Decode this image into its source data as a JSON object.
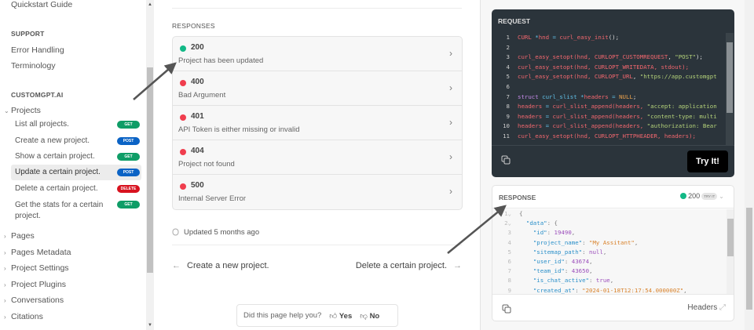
{
  "sidebar": {
    "quickstart": "Quickstart Guide",
    "support_heading": "SUPPORT",
    "support_links": [
      "Error Handling",
      "Terminology"
    ],
    "section_heading": "CUSTOMGPT.AI",
    "expanded_group": "Projects",
    "items": [
      {
        "label": "List all projects.",
        "method": "GET",
        "color": "#0f9d67"
      },
      {
        "label": "Create a new project.",
        "method": "POST",
        "color": "#0b63c5"
      },
      {
        "label": "Show a certain project.",
        "method": "GET",
        "color": "#0f9d67"
      },
      {
        "label": "Update a certain project.",
        "method": "POST",
        "color": "#0b63c5",
        "active": true
      },
      {
        "label": "Delete a certain project.",
        "method": "DELETE",
        "color": "#d8121f"
      },
      {
        "label": "Get the stats for a certain project.",
        "method": "GET",
        "color": "#0f9d67"
      }
    ],
    "groups": [
      "Pages",
      "Pages Metadata",
      "Project Settings",
      "Project Plugins",
      "Conversations",
      "Citations"
    ]
  },
  "main": {
    "responses_label": "RESPONSES",
    "responses": [
      {
        "code": "200",
        "description": "Project has been updated",
        "color": "#12b886"
      },
      {
        "code": "400",
        "description": "Bad Argument",
        "color": "#f03e4e"
      },
      {
        "code": "401",
        "description": "API Token is either missing or invalid",
        "color": "#f03e4e"
      },
      {
        "code": "404",
        "description": "Project not found",
        "color": "#f03e4e"
      },
      {
        "code": "500",
        "description": "Internal Server Error",
        "color": "#f03e4e"
      }
    ],
    "updated": "Updated 5 months ago",
    "prev": "Create a new project.",
    "next": "Delete a certain project.",
    "feedback": {
      "question": "Did this page help you?",
      "yes": "Yes",
      "no": "No"
    }
  },
  "request": {
    "title": "REQUEST",
    "try_label": "Try It!",
    "lines": [
      [
        [
          "CURL ",
          "r"
        ],
        [
          "*",
          "b"
        ],
        [
          "hnd ",
          "r"
        ],
        [
          "= ",
          "b"
        ],
        [
          "curl_easy_init",
          "r"
        ],
        [
          "();",
          "w"
        ]
      ],
      [],
      [
        [
          "curl_easy_setopt",
          "r"
        ],
        [
          "(hnd, ",
          "r"
        ],
        [
          "CURLOPT_CUSTOMREQUEST",
          "r"
        ],
        [
          ", ",
          "w"
        ],
        [
          "\"POST\"",
          "g"
        ],
        [
          ");",
          "w"
        ]
      ],
      [
        [
          "curl_easy_setopt",
          "r"
        ],
        [
          "(hnd, ",
          "r"
        ],
        [
          "CURLOPT_WRITEDATA",
          "r"
        ],
        [
          ", stdout);",
          "r"
        ]
      ],
      [
        [
          "curl_easy_setopt",
          "r"
        ],
        [
          "(hnd, ",
          "r"
        ],
        [
          "CURLOPT_URL",
          "r"
        ],
        [
          ", ",
          "w"
        ],
        [
          "\"https://app.customgpt",
          "g"
        ]
      ],
      [],
      [
        [
          "struct ",
          "p"
        ],
        [
          "curl_slist ",
          "b"
        ],
        [
          "*",
          "b"
        ],
        [
          "headers ",
          "r"
        ],
        [
          "= ",
          "b"
        ],
        [
          "NULL",
          "o"
        ],
        [
          ";",
          "w"
        ]
      ],
      [
        [
          "headers ",
          "r"
        ],
        [
          "= ",
          "b"
        ],
        [
          "curl_slist_append",
          "r"
        ],
        [
          "(headers, ",
          "r"
        ],
        [
          "\"accept: application",
          "g"
        ]
      ],
      [
        [
          "headers ",
          "r"
        ],
        [
          "= ",
          "b"
        ],
        [
          "curl_slist_append",
          "r"
        ],
        [
          "(headers, ",
          "r"
        ],
        [
          "\"content-type: multi",
          "g"
        ]
      ],
      [
        [
          "headers ",
          "r"
        ],
        [
          "= ",
          "b"
        ],
        [
          "curl_slist_append",
          "r"
        ],
        [
          "(headers, ",
          "r"
        ],
        [
          "\"authorization: Bear",
          "g"
        ]
      ],
      [
        [
          "curl_easy_setopt",
          "r"
        ],
        [
          "(hnd, ",
          "r"
        ],
        [
          "CURLOPT_HTTPHEADER",
          "r"
        ],
        [
          ", headers);",
          "r"
        ]
      ]
    ]
  },
  "response": {
    "title": "RESPONSE",
    "status": "200",
    "status_tag": "TRY IT",
    "headers_label": "Headers",
    "lines": [
      [
        [
          "{",
          "w"
        ]
      ],
      [
        [
          "  ",
          "w"
        ],
        [
          "\"data\"",
          "b"
        ],
        [
          ": {",
          "w"
        ]
      ],
      [
        [
          "    ",
          "w"
        ],
        [
          "\"id\"",
          "b"
        ],
        [
          ": ",
          "w"
        ],
        [
          "19490",
          "p"
        ],
        [
          ",",
          "w"
        ]
      ],
      [
        [
          "    ",
          "w"
        ],
        [
          "\"project_name\"",
          "b"
        ],
        [
          ": ",
          "w"
        ],
        [
          "\"My Assitant\"",
          "o"
        ],
        [
          ",",
          "w"
        ]
      ],
      [
        [
          "    ",
          "w"
        ],
        [
          "\"sitemap_path\"",
          "b"
        ],
        [
          ": ",
          "w"
        ],
        [
          "null",
          "p"
        ],
        [
          ",",
          "w"
        ]
      ],
      [
        [
          "    ",
          "w"
        ],
        [
          "\"user_id\"",
          "b"
        ],
        [
          ": ",
          "w"
        ],
        [
          "43674",
          "p"
        ],
        [
          ",",
          "w"
        ]
      ],
      [
        [
          "    ",
          "w"
        ],
        [
          "\"team_id\"",
          "b"
        ],
        [
          ": ",
          "w"
        ],
        [
          "43650",
          "p"
        ],
        [
          ",",
          "w"
        ]
      ],
      [
        [
          "    ",
          "w"
        ],
        [
          "\"is_chat_active\"",
          "b"
        ],
        [
          ": ",
          "w"
        ],
        [
          "true",
          "p"
        ],
        [
          ",",
          "w"
        ]
      ],
      [
        [
          "    ",
          "w"
        ],
        [
          "\"created_at\"",
          "b"
        ],
        [
          ": ",
          "w"
        ],
        [
          "\"2024-01-18T12:17:54.000000Z\"",
          "o"
        ],
        [
          ",",
          "w"
        ]
      ]
    ]
  }
}
